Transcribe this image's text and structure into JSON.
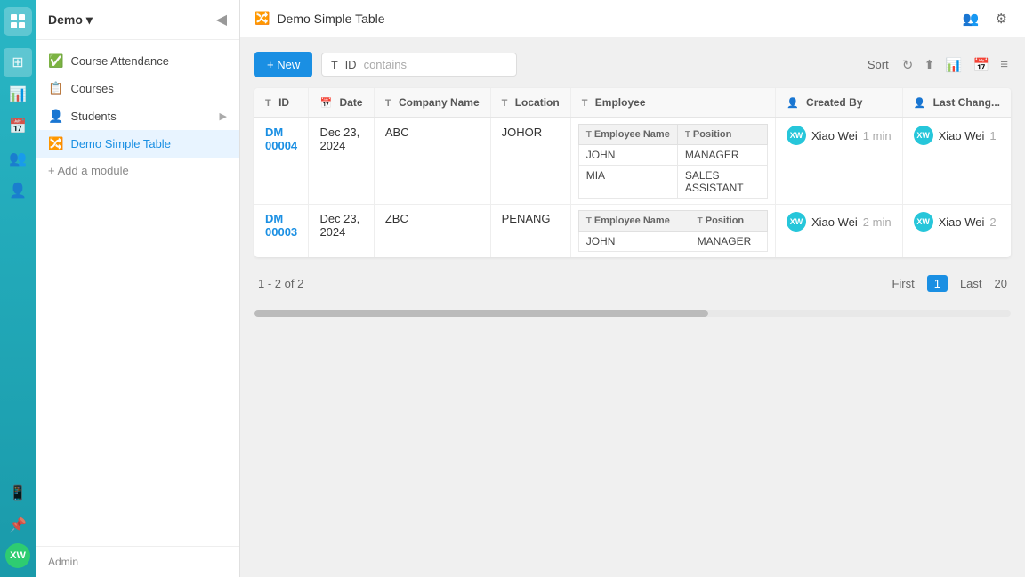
{
  "app": {
    "demo_label": "Demo",
    "collapse_icon": "◀"
  },
  "sidebar": {
    "items": [
      {
        "id": "course-attendance",
        "label": "Course Attendance",
        "icon": "✅"
      },
      {
        "id": "courses",
        "label": "Courses",
        "icon": "📋"
      },
      {
        "id": "students",
        "label": "Students",
        "icon": "👤",
        "has_sub": true
      },
      {
        "id": "demo-simple-table",
        "label": "Demo Simple Table",
        "icon": "🔀",
        "active": true
      }
    ],
    "add_module_label": "+ Add a module",
    "footer_label": "Admin"
  },
  "topbar": {
    "icon": "🔀",
    "title": "Demo Simple Table"
  },
  "toolbar": {
    "new_label": "+ New"
  },
  "filter": {
    "icon_label": "T",
    "field": "ID",
    "operator": "contains"
  },
  "sort": {
    "label": "Sort"
  },
  "table": {
    "columns": [
      {
        "id": "id",
        "label": "ID",
        "icon": "T"
      },
      {
        "id": "date",
        "label": "Date",
        "icon": "📅"
      },
      {
        "id": "company",
        "label": "Company Name",
        "icon": "T"
      },
      {
        "id": "location",
        "label": "Location",
        "icon": "T"
      },
      {
        "id": "employee",
        "label": "Employee",
        "icon": "T"
      },
      {
        "id": "created_by",
        "label": "Created By",
        "icon": "👤"
      },
      {
        "id": "last_changed",
        "label": "Last Chang...",
        "icon": "👤"
      }
    ],
    "employee_sub_columns": [
      {
        "id": "emp_name",
        "label": "Employee Name",
        "icon": "T"
      },
      {
        "id": "position",
        "label": "Position",
        "icon": "T"
      }
    ],
    "rows": [
      {
        "id": "DM 00004",
        "date": "Dec 23, 2024",
        "company": "ABC",
        "location": "JOHOR",
        "employees": [
          {
            "name": "JOHN",
            "position": "MANAGER"
          },
          {
            "name": "MIA",
            "position": "SALES ASSISTANT"
          }
        ],
        "created_by": "Xiao Wei",
        "created_time": "1 min",
        "last_changed": "Xiao Wei",
        "last_changed_time": "1"
      },
      {
        "id": "DM 00003",
        "date": "Dec 23, 2024",
        "company": "ZBC",
        "location": "PENANG",
        "employees": [
          {
            "name": "JOHN",
            "position": "MANAGER"
          }
        ],
        "created_by": "Xiao Wei",
        "created_time": "2 min",
        "last_changed": "Xiao Wei",
        "last_changed_time": "2"
      }
    ]
  },
  "pagination": {
    "summary": "1 - 2 of 2",
    "first_label": "First",
    "last_label": "Last",
    "current_page": "1",
    "page_size": "20"
  },
  "icons": {
    "sort": "⇅",
    "reload": "↻",
    "export": "⬆",
    "chart": "📊",
    "calendar": "📅",
    "list": "≡",
    "settings": "⚙",
    "user_plus": "👥"
  }
}
